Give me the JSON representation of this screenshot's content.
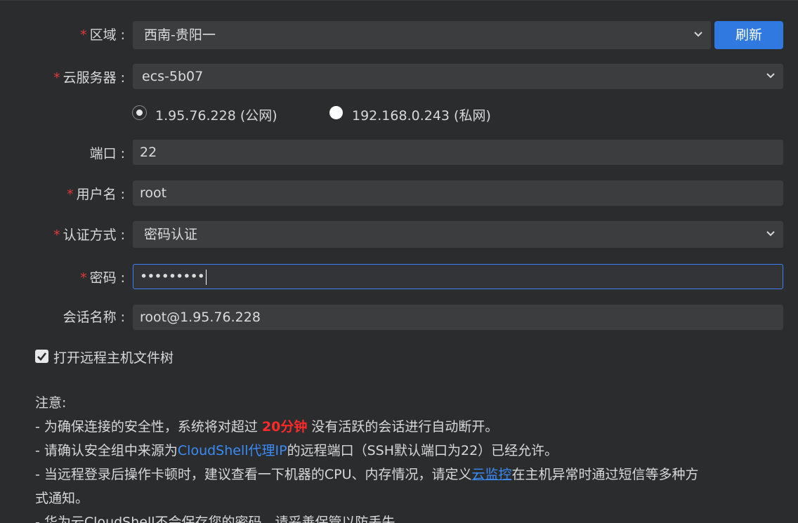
{
  "region": {
    "label": "区域",
    "value": "西南-贵阳一",
    "refresh_label": "刷新"
  },
  "server": {
    "label": "云服务器",
    "value": "ecs-5b07",
    "ip_options": [
      {
        "label": "1.95.76.228 (公网)",
        "selected": true
      },
      {
        "label": "192.168.0.243 (私网)",
        "selected": false
      }
    ]
  },
  "port": {
    "label": "端口",
    "value": "22"
  },
  "username": {
    "label": "用户名",
    "value": "root"
  },
  "auth": {
    "label": "认证方式",
    "value": "密码认证"
  },
  "password": {
    "label": "密码",
    "value": "•••••••••"
  },
  "session": {
    "label": "会话名称",
    "value": "root@1.95.76.228"
  },
  "open_file_tree": {
    "label": "打开远程主机文件树",
    "checked": true
  },
  "notes": {
    "title": "注意:",
    "line1_pre": "- 为确保连接的安全性，系统将对超过 ",
    "line1_highlight": "20分钟",
    "line1_post": " 没有活跃的会话进行自动断开。",
    "line2_pre": "- 请确认安全组中来源为",
    "line2_link": "CloudShell代理IP",
    "line2_post": "的远程端口（SSH默认端口为22）已经允许。",
    "line3_pre": "- 当远程登录后操作卡顿时，建议查看一下机器的CPU、内存情况，请定义",
    "line3_link": "云监控",
    "line3_post": "在主机异常时通过短信等多种方",
    "line3_cont": "式通知。",
    "line4": "- 华为云CloudShell不会保存您的密码，请妥善保管以防丢失。"
  },
  "colors": {
    "background": "#2b2c2e",
    "field": "#3c3d3f",
    "primary": "#2f79e0",
    "required": "#e03a3a",
    "highlight_red": "#ff2a2a",
    "link": "#3b8cf6"
  }
}
